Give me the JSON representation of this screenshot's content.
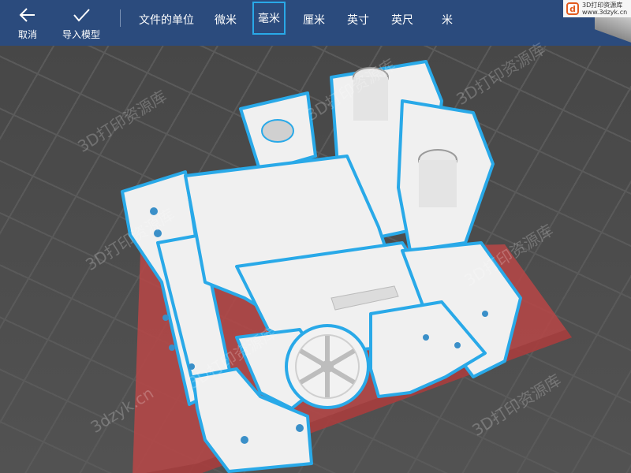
{
  "toolbar": {
    "cancel_label": "取消",
    "import_label": "导入模型",
    "units_title": "文件的单位",
    "units": [
      {
        "label": "微米",
        "selected": false
      },
      {
        "label": "毫米",
        "selected": true
      },
      {
        "label": "厘米",
        "selected": false
      },
      {
        "label": "英寸",
        "selected": false
      },
      {
        "label": "英尺",
        "selected": false
      },
      {
        "label": "米",
        "selected": false
      }
    ]
  },
  "corner_logo": {
    "brand": "3D打印资源库",
    "url": "www.3dzyk.cn"
  },
  "watermark": {
    "brand": "3D打印资源库",
    "url": "3dzyk.cn"
  },
  "colors": {
    "toolbar_bg": "#2b4b7d",
    "selection_outline": "#29a9e8",
    "build_plate": "#b84747",
    "part_color": "#f1f1f1"
  }
}
